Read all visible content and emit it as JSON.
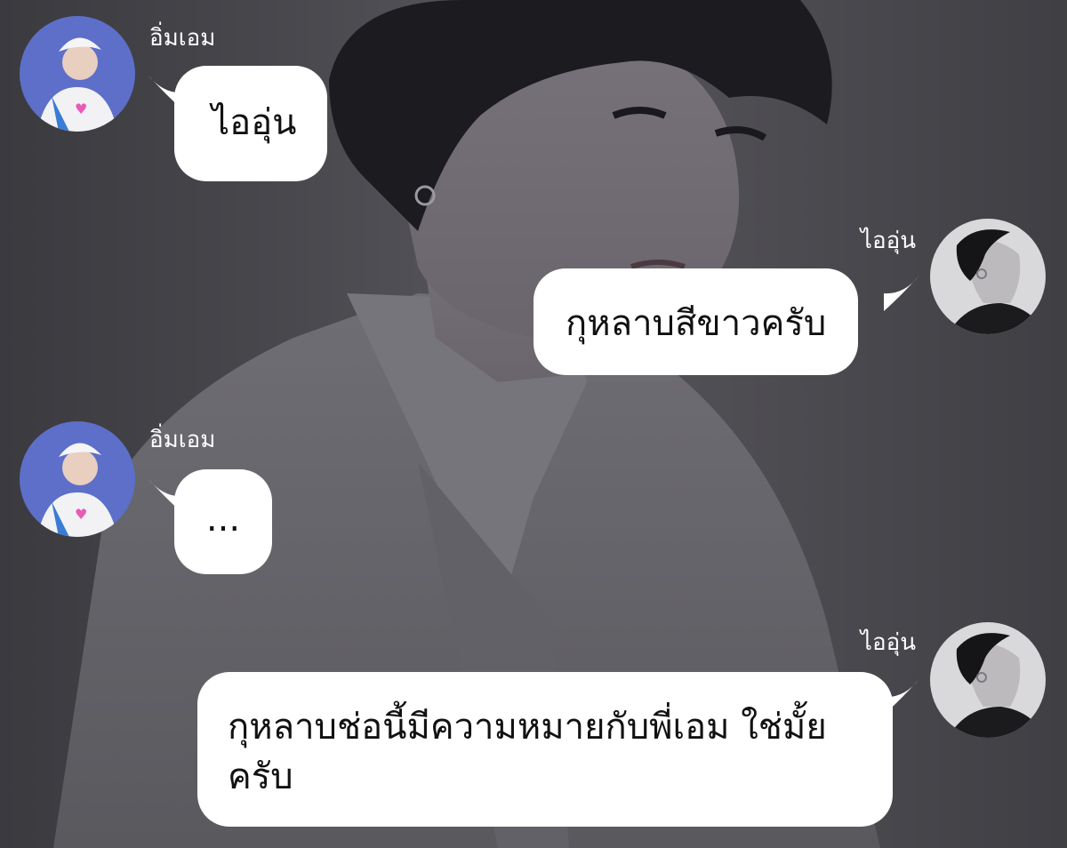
{
  "conversation": {
    "messages": [
      {
        "sender": "อิ่มเอม",
        "side": "left",
        "text": "ไออุ่น",
        "avatar": "avatar-blue-hat"
      },
      {
        "sender": "ไออุ่น",
        "side": "right",
        "text": "กุหลาบสีขาวครับ",
        "avatar": "avatar-dark-profile"
      },
      {
        "sender": "อิ่มเอม",
        "side": "left",
        "text": "...",
        "avatar": "avatar-blue-hat"
      },
      {
        "sender": "ไออุ่น",
        "side": "right",
        "text": "กุหลาบช่อนี้มีความหมายกับพี่เอม ใช่มั้ยครับ",
        "avatar": "avatar-dark-profile"
      }
    ]
  },
  "colors": {
    "bubble": "#ffffff",
    "text": "#111111",
    "name": "#ffffff",
    "background": "#4a4a4f"
  }
}
